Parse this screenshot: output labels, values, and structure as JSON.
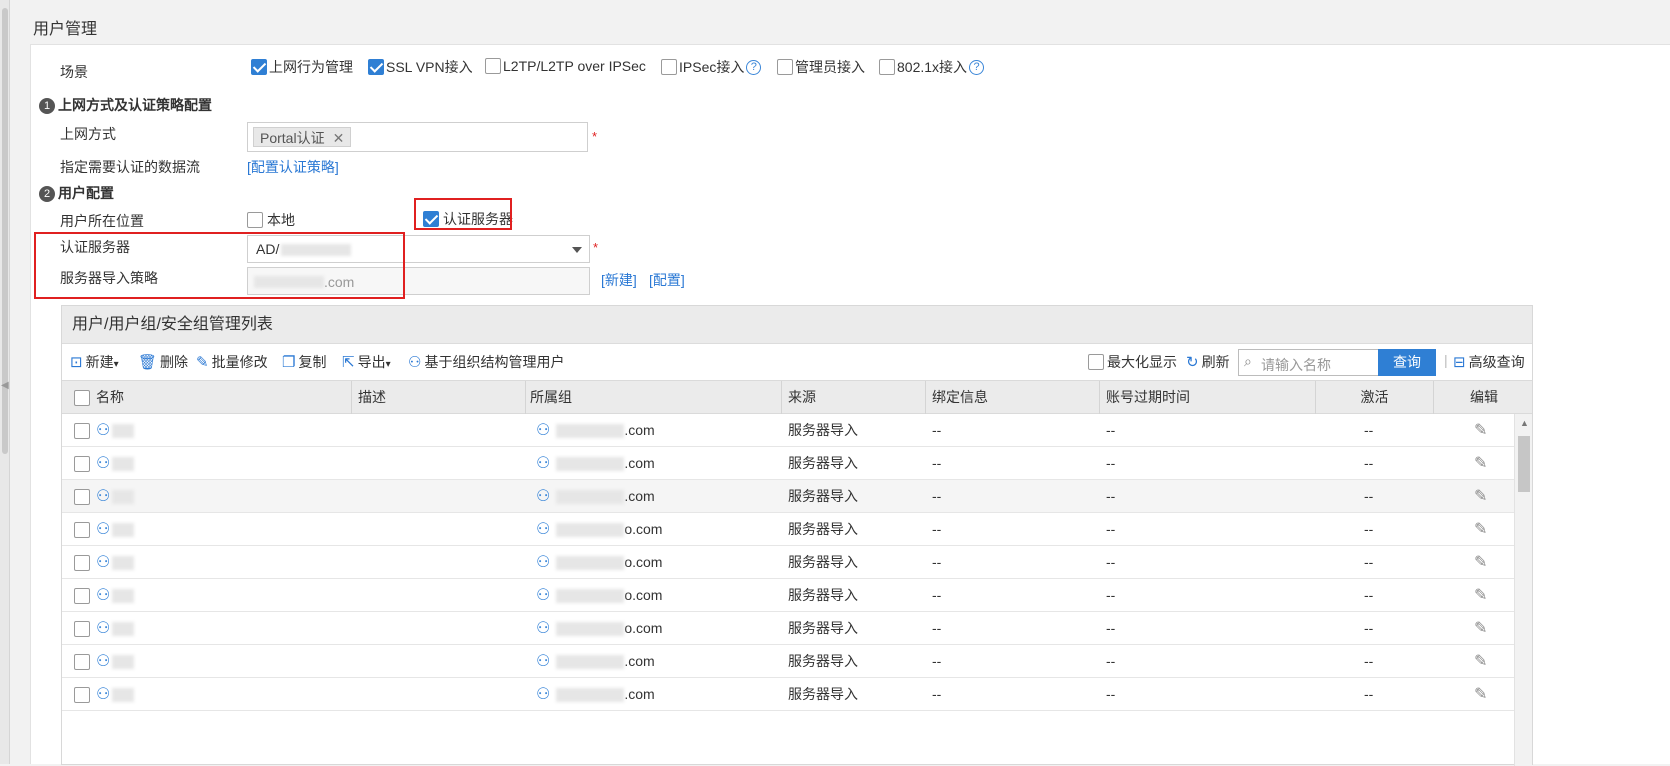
{
  "page_title": "用户管理",
  "scenario": {
    "label": "场景",
    "options": [
      {
        "label": "上网行为管理",
        "checked": true,
        "help": false
      },
      {
        "label": "SSL VPN接入",
        "checked": true,
        "help": false
      },
      {
        "label": "L2TP/L2TP over IPSec",
        "checked": false,
        "help": false
      },
      {
        "label": "IPSec接入",
        "checked": false,
        "help": true
      },
      {
        "label": "管理员接入",
        "checked": false,
        "help": false
      },
      {
        "label": "802.1x接入",
        "checked": false,
        "help": true
      }
    ]
  },
  "section1": {
    "number": "1",
    "title": "上网方式及认证策略配置",
    "access_mode_label": "上网方式",
    "access_mode_tag": "Portal认证",
    "tag_remove": "✕",
    "required_mark": "*",
    "flow_label": "指定需要认证的数据流",
    "flow_link": "[配置认证策略]"
  },
  "section2": {
    "number": "2",
    "title": "用户配置",
    "location_label": "用户所在位置",
    "location_local": "本地",
    "location_server": "认证服务器",
    "auth_server_label": "认证服务器",
    "auth_server_value": "AD/",
    "import_policy_label": "服务器导入策略",
    "import_policy_value": ".com",
    "link_new": "[新建]",
    "link_config": "[配置]"
  },
  "grid": {
    "title": "用户/用户组/安全组管理列表",
    "toolbar": {
      "new": "新建",
      "delete": "删除",
      "batch_edit": "批量修改",
      "copy": "复制",
      "export": "导出",
      "org_manage": "基于组织结构管理用户",
      "maximize": "最大化显示",
      "refresh": "刷新",
      "search_placeholder": "请输入名称",
      "search_button": "查询",
      "advanced_search": "高级查询"
    },
    "columns": [
      "名称",
      "描述",
      "所属组",
      "来源",
      "绑定信息",
      "账号过期时间",
      "激活",
      "编辑"
    ],
    "rows": [
      {
        "group": ".com",
        "source": "服务器导入",
        "binding": "--",
        "expire": "--",
        "active": "--"
      },
      {
        "group": ".com",
        "source": "服务器导入",
        "binding": "--",
        "expire": "--",
        "active": "--"
      },
      {
        "group": ".com",
        "source": "服务器导入",
        "binding": "--",
        "expire": "--",
        "active": "--"
      },
      {
        "group": "o.com",
        "source": "服务器导入",
        "binding": "--",
        "expire": "--",
        "active": "--"
      },
      {
        "group": "o.com",
        "source": "服务器导入",
        "binding": "--",
        "expire": "--",
        "active": "--"
      },
      {
        "group": "o.com",
        "source": "服务器导入",
        "binding": "--",
        "expire": "--",
        "active": "--"
      },
      {
        "group": "o.com",
        "source": "服务器导入",
        "binding": "--",
        "expire": "--",
        "active": "--"
      },
      {
        "group": ".com",
        "source": "服务器导入",
        "binding": "--",
        "expire": "--",
        "active": "--"
      },
      {
        "group": ".com",
        "source": "服务器导入",
        "binding": "--",
        "expire": "--",
        "active": "--"
      }
    ]
  },
  "colors": {
    "accent": "#2f7fd4",
    "highlight_box": "#e02020",
    "link": "#2a78d4"
  }
}
